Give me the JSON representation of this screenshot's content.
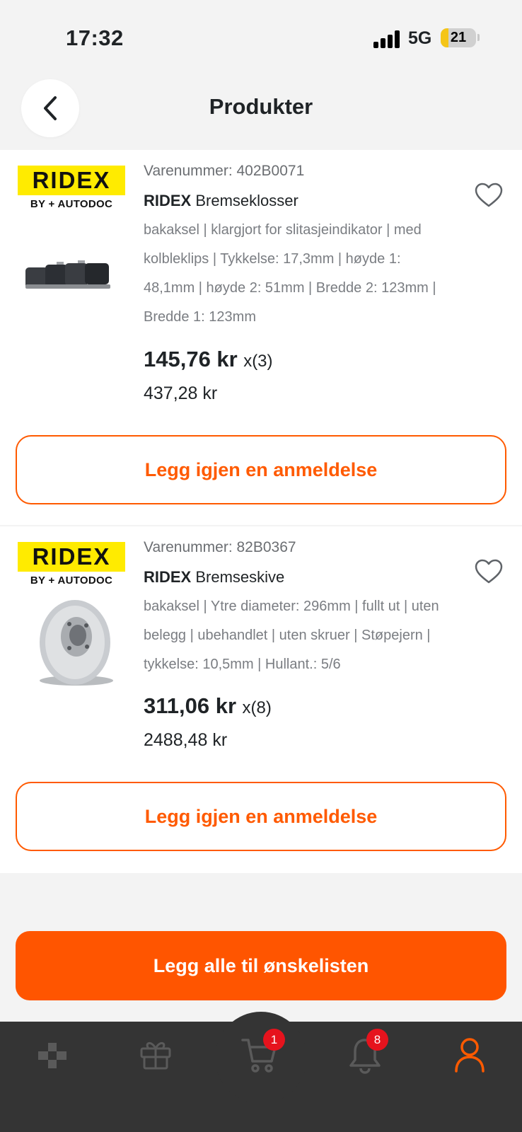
{
  "status_bar": {
    "time": "17:32",
    "network": "5G",
    "battery": "21"
  },
  "header": {
    "title": "Produkter"
  },
  "products": [
    {
      "brand_logo": "RIDEX",
      "brand_logo_sub": "BY + AUTODOC",
      "sku": "Varenummer: 402B0071",
      "brand": "RIDEX",
      "name": "Bremseklosser",
      "description": "bakaksel | klargjort for slitasjeindikator | med kolbleklips | Tykkelse: 17,3mm | høyde 1: 48,1mm | høyde 2: 51mm | Bredde 2: 123mm | Bredde 1: 123mm",
      "price": "145,76 kr",
      "quantity": "x(3)",
      "total": "437,28 kr",
      "review_label": "Legg igjen en anmeldelse"
    },
    {
      "brand_logo": "RIDEX",
      "brand_logo_sub": "BY + AUTODOC",
      "sku": "Varenummer: 82B0367",
      "brand": "RIDEX",
      "name": "Bremseskive",
      "description": "bakaksel | Ytre diameter: 296mm | fullt ut | uten belegg | ubehandlet | uten skruer | Støpejern | tykkelse: 10,5mm | Hullant.: 5/6",
      "price": "311,06 kr",
      "quantity": "x(8)",
      "total": "2488,48 kr",
      "review_label": "Legg igjen en anmeldelse"
    }
  ],
  "wishlist_button": "Legg alle til ønskelisten",
  "tabbar": {
    "cart_badge": "1",
    "notifications_badge": "8",
    "accent": "#ff5a00"
  }
}
